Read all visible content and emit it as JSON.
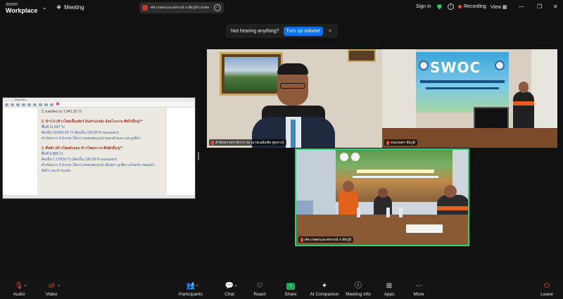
{
  "app": {
    "brand_small": "zoom",
    "brand": "Workplace"
  },
  "topbar": {
    "meeting_label": "Meeting",
    "share_title": "ศพ.เกษตรและสหกรณ์ จ.ชัยภูมิ's scree",
    "sign_in": "Sign in",
    "recording": "Recording",
    "view": "View"
  },
  "notice": {
    "message": "Not hearing anything?",
    "button": "Turn up volume",
    "close": "×"
  },
  "shared_screen": {
    "window_title": "... - ... - IrfanView",
    "lines": [
      {
        "text": "3. ผลผลิตรวม 7,941.23 ไร่",
        "style": "gray"
      },
      {
        "text": "",
        "style": "gap"
      },
      {
        "text": "2. ข้าวไร่ (ข้าวโพดเลี้ยงสัตว์ มันสำปะหลัง อ้อยโรงงาน พืชไร่อื่นๆ)**",
        "style": "red"
      },
      {
        "text": "พื้นที่ 11,937 ไร่",
        "style": "blue"
      },
      {
        "text": "คิดเป็น 10,559.25 ไร่ (คิดเป็น 103.93 % ของแผนฯ)",
        "style": "blue"
      },
      {
        "text": "ดำเนินการ 3 อำเภอ ได้แก่ เกษตรสมบูรณ์ หนองบัวแดง และภูเขียว",
        "style": "blue"
      },
      {
        "text": "",
        "style": "gap"
      },
      {
        "text": "3. พืชผัก (ข้าวโพดฝักอ่อน ข้าวโพดหวาน พืชผักอื่นๆ)**",
        "style": "red"
      },
      {
        "text": "พื้นที่ 5,965 ไร่",
        "style": "blue"
      },
      {
        "text": "คิดเป็น 7,174.55 ไร่ (คิดเป็น 120.28 % ของแผนฯ)",
        "style": "blue"
      },
      {
        "text": "ดำเนินการ 3 อำเภอ ได้แก่ เกษตรสมบูรณ์ เนินสง่า ภูเขียว แก้งคร้อ หนองบัว",
        "style": "blue"
      },
      {
        "text": "ลิสไก และบ้านแท่น",
        "style": "blue"
      }
    ]
  },
  "participants": [
    {
      "name": "สำนักตรวจราชการ กษ (นายเฉลิมชัย พูลลาภ)",
      "speaking": false
    },
    {
      "name": "คนเกษตร ชัยภูมิ",
      "speaking": false
    },
    {
      "name": "ศพ.เกษตรและสหกรณ์ จ.ชัยภูมิ",
      "speaking": true
    }
  ],
  "tile2_banner": {
    "logo_text": "SWOC"
  },
  "toolbar": {
    "audio": "Audio",
    "video": "Video",
    "participants": "Participants",
    "participants_count": "5",
    "chat": "Chat",
    "react": "React",
    "share": "Share",
    "ai_companion": "AI Companion",
    "meeting_info": "Meeting info",
    "apps": "Apps",
    "more": "More",
    "leave": "Leave"
  },
  "colors": {
    "accent": "#0e72ed",
    "speaker_border": "#2fce72",
    "share_green": "#23a455",
    "rec_red": "#e74c3c"
  }
}
